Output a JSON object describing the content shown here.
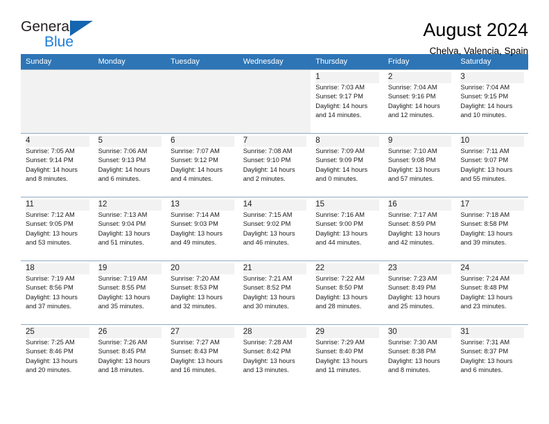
{
  "brand": {
    "name_line1": "General",
    "name_line2": "Blue",
    "triangle_color": "#1565b0",
    "blue_text_color": "#1d7dd6"
  },
  "header": {
    "title": "August 2024",
    "location": "Chelva, Valencia, Spain"
  },
  "theme": {
    "header_row_bg": "#2e75b6",
    "header_row_text": "#ffffff",
    "shaded_cell_bg": "#f2f2f2",
    "grid_line": "#8ea9c1"
  },
  "weekdays": [
    "Sunday",
    "Monday",
    "Tuesday",
    "Wednesday",
    "Thursday",
    "Friday",
    "Saturday"
  ],
  "weeks": [
    [
      {
        "day": "",
        "sunrise": "",
        "sunset": "",
        "daylight1": "",
        "daylight2": ""
      },
      {
        "day": "",
        "sunrise": "",
        "sunset": "",
        "daylight1": "",
        "daylight2": ""
      },
      {
        "day": "",
        "sunrise": "",
        "sunset": "",
        "daylight1": "",
        "daylight2": ""
      },
      {
        "day": "",
        "sunrise": "",
        "sunset": "",
        "daylight1": "",
        "daylight2": ""
      },
      {
        "day": "1",
        "sunrise": "Sunrise: 7:03 AM",
        "sunset": "Sunset: 9:17 PM",
        "daylight1": "Daylight: 14 hours",
        "daylight2": "and 14 minutes."
      },
      {
        "day": "2",
        "sunrise": "Sunrise: 7:04 AM",
        "sunset": "Sunset: 9:16 PM",
        "daylight1": "Daylight: 14 hours",
        "daylight2": "and 12 minutes."
      },
      {
        "day": "3",
        "sunrise": "Sunrise: 7:04 AM",
        "sunset": "Sunset: 9:15 PM",
        "daylight1": "Daylight: 14 hours",
        "daylight2": "and 10 minutes."
      }
    ],
    [
      {
        "day": "4",
        "sunrise": "Sunrise: 7:05 AM",
        "sunset": "Sunset: 9:14 PM",
        "daylight1": "Daylight: 14 hours",
        "daylight2": "and 8 minutes."
      },
      {
        "day": "5",
        "sunrise": "Sunrise: 7:06 AM",
        "sunset": "Sunset: 9:13 PM",
        "daylight1": "Daylight: 14 hours",
        "daylight2": "and 6 minutes."
      },
      {
        "day": "6",
        "sunrise": "Sunrise: 7:07 AM",
        "sunset": "Sunset: 9:12 PM",
        "daylight1": "Daylight: 14 hours",
        "daylight2": "and 4 minutes."
      },
      {
        "day": "7",
        "sunrise": "Sunrise: 7:08 AM",
        "sunset": "Sunset: 9:10 PM",
        "daylight1": "Daylight: 14 hours",
        "daylight2": "and 2 minutes."
      },
      {
        "day": "8",
        "sunrise": "Sunrise: 7:09 AM",
        "sunset": "Sunset: 9:09 PM",
        "daylight1": "Daylight: 14 hours",
        "daylight2": "and 0 minutes."
      },
      {
        "day": "9",
        "sunrise": "Sunrise: 7:10 AM",
        "sunset": "Sunset: 9:08 PM",
        "daylight1": "Daylight: 13 hours",
        "daylight2": "and 57 minutes."
      },
      {
        "day": "10",
        "sunrise": "Sunrise: 7:11 AM",
        "sunset": "Sunset: 9:07 PM",
        "daylight1": "Daylight: 13 hours",
        "daylight2": "and 55 minutes."
      }
    ],
    [
      {
        "day": "11",
        "sunrise": "Sunrise: 7:12 AM",
        "sunset": "Sunset: 9:05 PM",
        "daylight1": "Daylight: 13 hours",
        "daylight2": "and 53 minutes."
      },
      {
        "day": "12",
        "sunrise": "Sunrise: 7:13 AM",
        "sunset": "Sunset: 9:04 PM",
        "daylight1": "Daylight: 13 hours",
        "daylight2": "and 51 minutes."
      },
      {
        "day": "13",
        "sunrise": "Sunrise: 7:14 AM",
        "sunset": "Sunset: 9:03 PM",
        "daylight1": "Daylight: 13 hours",
        "daylight2": "and 49 minutes."
      },
      {
        "day": "14",
        "sunrise": "Sunrise: 7:15 AM",
        "sunset": "Sunset: 9:02 PM",
        "daylight1": "Daylight: 13 hours",
        "daylight2": "and 46 minutes."
      },
      {
        "day": "15",
        "sunrise": "Sunrise: 7:16 AM",
        "sunset": "Sunset: 9:00 PM",
        "daylight1": "Daylight: 13 hours",
        "daylight2": "and 44 minutes."
      },
      {
        "day": "16",
        "sunrise": "Sunrise: 7:17 AM",
        "sunset": "Sunset: 8:59 PM",
        "daylight1": "Daylight: 13 hours",
        "daylight2": "and 42 minutes."
      },
      {
        "day": "17",
        "sunrise": "Sunrise: 7:18 AM",
        "sunset": "Sunset: 8:58 PM",
        "daylight1": "Daylight: 13 hours",
        "daylight2": "and 39 minutes."
      }
    ],
    [
      {
        "day": "18",
        "sunrise": "Sunrise: 7:19 AM",
        "sunset": "Sunset: 8:56 PM",
        "daylight1": "Daylight: 13 hours",
        "daylight2": "and 37 minutes."
      },
      {
        "day": "19",
        "sunrise": "Sunrise: 7:19 AM",
        "sunset": "Sunset: 8:55 PM",
        "daylight1": "Daylight: 13 hours",
        "daylight2": "and 35 minutes."
      },
      {
        "day": "20",
        "sunrise": "Sunrise: 7:20 AM",
        "sunset": "Sunset: 8:53 PM",
        "daylight1": "Daylight: 13 hours",
        "daylight2": "and 32 minutes."
      },
      {
        "day": "21",
        "sunrise": "Sunrise: 7:21 AM",
        "sunset": "Sunset: 8:52 PM",
        "daylight1": "Daylight: 13 hours",
        "daylight2": "and 30 minutes."
      },
      {
        "day": "22",
        "sunrise": "Sunrise: 7:22 AM",
        "sunset": "Sunset: 8:50 PM",
        "daylight1": "Daylight: 13 hours",
        "daylight2": "and 28 minutes."
      },
      {
        "day": "23",
        "sunrise": "Sunrise: 7:23 AM",
        "sunset": "Sunset: 8:49 PM",
        "daylight1": "Daylight: 13 hours",
        "daylight2": "and 25 minutes."
      },
      {
        "day": "24",
        "sunrise": "Sunrise: 7:24 AM",
        "sunset": "Sunset: 8:48 PM",
        "daylight1": "Daylight: 13 hours",
        "daylight2": "and 23 minutes."
      }
    ],
    [
      {
        "day": "25",
        "sunrise": "Sunrise: 7:25 AM",
        "sunset": "Sunset: 8:46 PM",
        "daylight1": "Daylight: 13 hours",
        "daylight2": "and 20 minutes."
      },
      {
        "day": "26",
        "sunrise": "Sunrise: 7:26 AM",
        "sunset": "Sunset: 8:45 PM",
        "daylight1": "Daylight: 13 hours",
        "daylight2": "and 18 minutes."
      },
      {
        "day": "27",
        "sunrise": "Sunrise: 7:27 AM",
        "sunset": "Sunset: 8:43 PM",
        "daylight1": "Daylight: 13 hours",
        "daylight2": "and 16 minutes."
      },
      {
        "day": "28",
        "sunrise": "Sunrise: 7:28 AM",
        "sunset": "Sunset: 8:42 PM",
        "daylight1": "Daylight: 13 hours",
        "daylight2": "and 13 minutes."
      },
      {
        "day": "29",
        "sunrise": "Sunrise: 7:29 AM",
        "sunset": "Sunset: 8:40 PM",
        "daylight1": "Daylight: 13 hours",
        "daylight2": "and 11 minutes."
      },
      {
        "day": "30",
        "sunrise": "Sunrise: 7:30 AM",
        "sunset": "Sunset: 8:38 PM",
        "daylight1": "Daylight: 13 hours",
        "daylight2": "and 8 minutes."
      },
      {
        "day": "31",
        "sunrise": "Sunrise: 7:31 AM",
        "sunset": "Sunset: 8:37 PM",
        "daylight1": "Daylight: 13 hours",
        "daylight2": "and 6 minutes."
      }
    ]
  ]
}
